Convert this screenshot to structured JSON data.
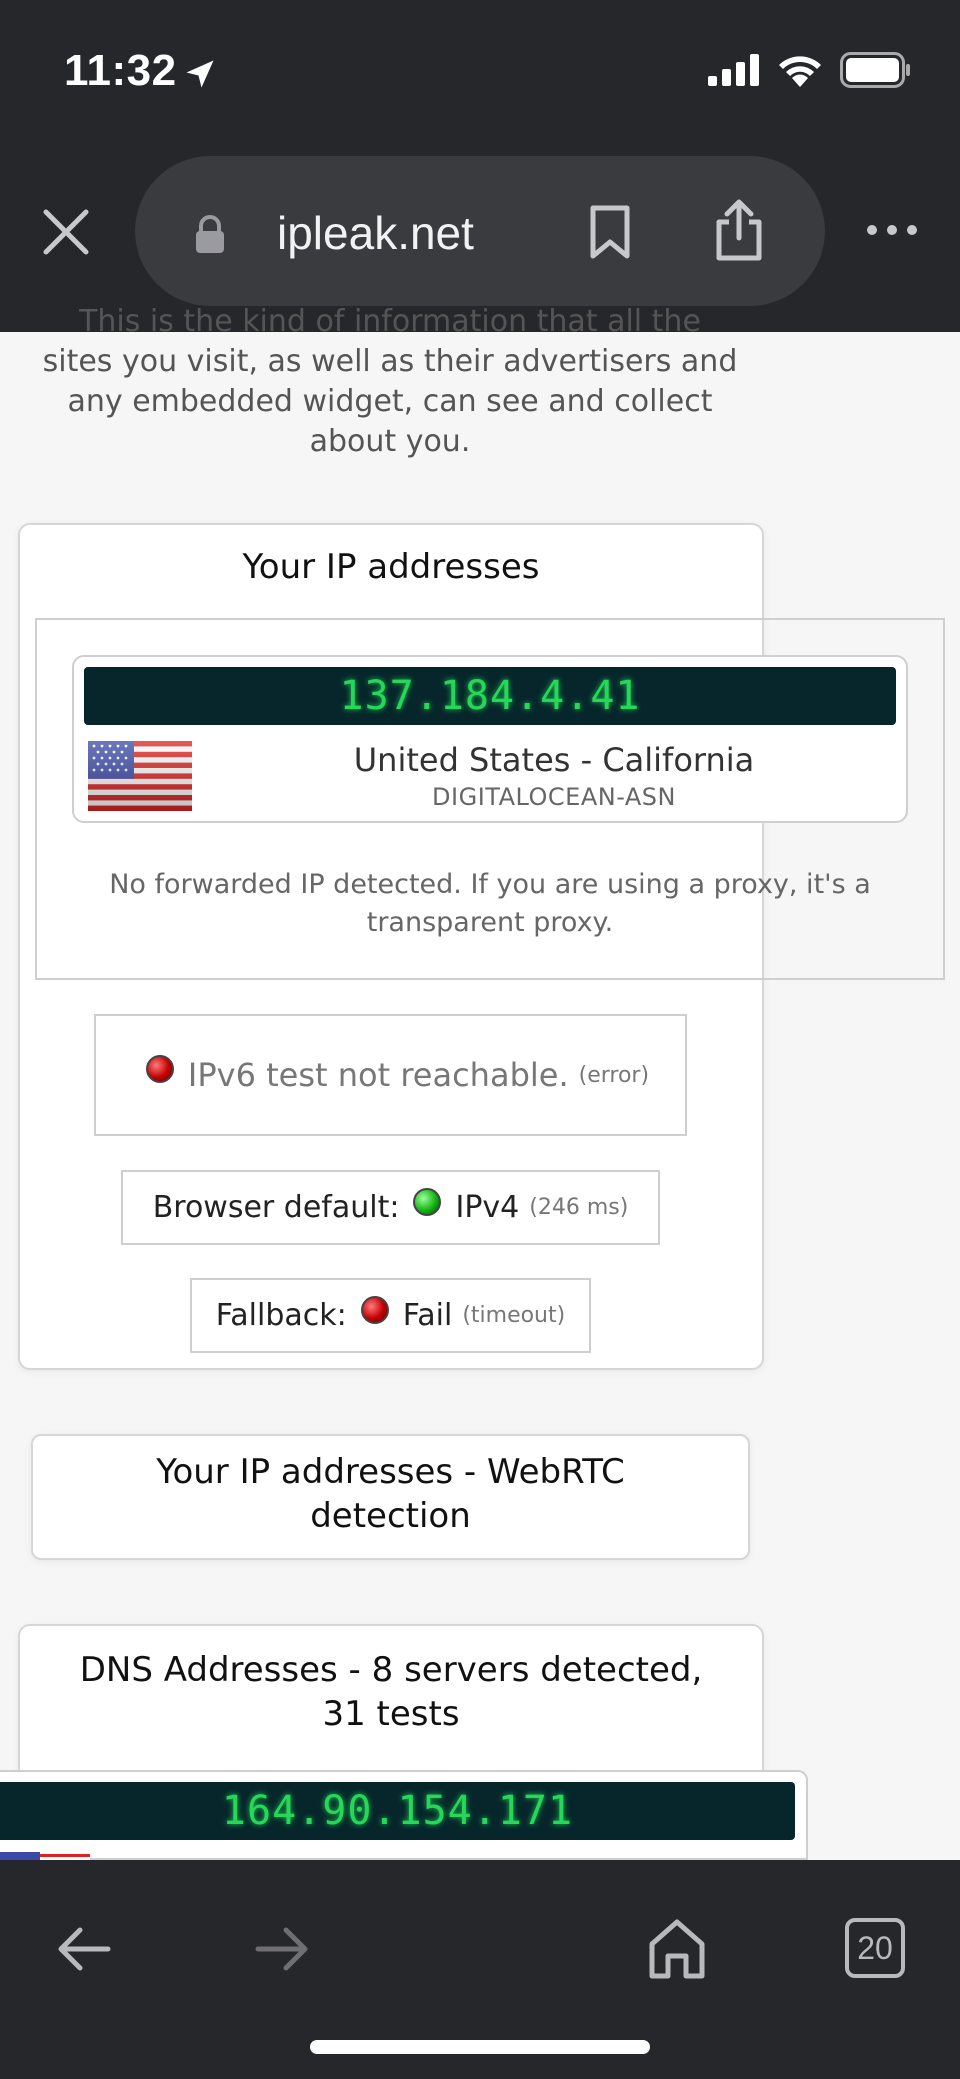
{
  "status_bar": {
    "time": "11:32",
    "icons": [
      "location-arrow-icon",
      "signal-icon",
      "wifi-icon",
      "battery-icon"
    ]
  },
  "browser": {
    "url": "ipleak.net",
    "tab_count": "20",
    "icons": [
      "close-icon",
      "lock-icon",
      "bookmark-icon",
      "share-icon",
      "more-icon",
      "back-icon",
      "forward-icon",
      "home-icon"
    ]
  },
  "intro": {
    "line0": "This is the kind of information that all the",
    "line1": "sites you visit, as well as their advertisers and",
    "line2": "any embedded widget, can see and collect",
    "line3": "about you."
  },
  "ip_card": {
    "title": "Your IP addresses",
    "ip": "137.184.4.41",
    "location": "United States - California",
    "isp": "DIGITALOCEAN-ASN",
    "forwarded_line1": "No forwarded IP detected. If you are using a proxy, it's a",
    "forwarded_line2": "transparent proxy.",
    "ipv6_text": "IPv6 test not reachable.",
    "ipv6_note": "(error)",
    "default_label": "Browser default:",
    "default_value": "IPv4",
    "default_note": "(246 ms)",
    "fallback_label": "Fallback:",
    "fallback_value": "Fail",
    "fallback_note": "(timeout)"
  },
  "webrtc_card": {
    "title_line1": "Your IP addresses - WebRTC",
    "title_line2": "detection"
  },
  "dns_card": {
    "title_line1": "DNS Addresses - 8 servers detected,",
    "title_line2": "31 tests",
    "first_ip": "164.90.154.171"
  },
  "colors": {
    "chrome": "#26272b",
    "ip_display_bg": "#07262c",
    "ip_display_text": "#27d75a",
    "status_red": "#c20000",
    "status_green": "#13b613"
  }
}
